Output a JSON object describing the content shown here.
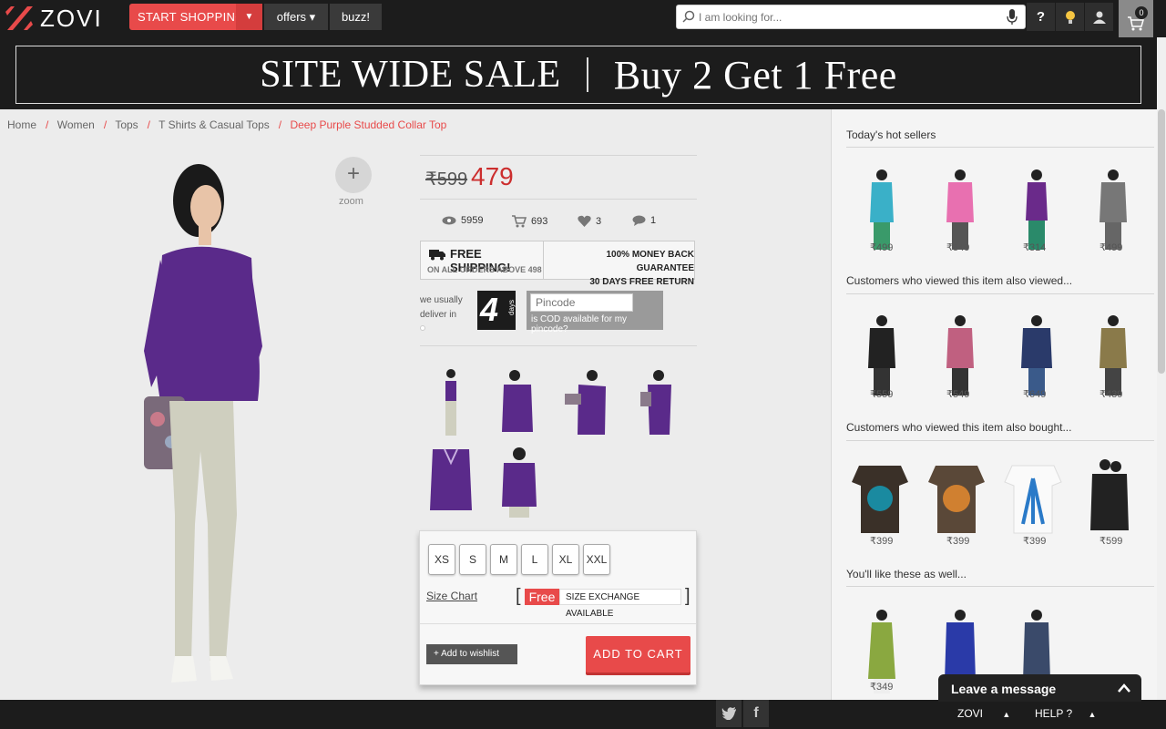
{
  "header": {
    "logo": "ZOVI",
    "start_shopping": "START SHOPPING",
    "offers": "offers",
    "buzz": "buzz!",
    "search_placeholder": "I am looking for...",
    "help_icon": "?",
    "cart_count": "0",
    "accent": "#e84a4a"
  },
  "banner": {
    "left": "SITE WIDE SALE",
    "right": "Buy 2 Get 1 Free"
  },
  "breadcrumb": [
    "Home",
    "Women",
    "Tops",
    "T Shirts & Casual Tops",
    "Deep Purple Studded Collar Top"
  ],
  "product": {
    "zoom_label": "zoom",
    "price_old": "₹599",
    "price_new": "479",
    "stats": {
      "views": "5959",
      "cart": "693",
      "likes": "3",
      "comments": "1"
    },
    "shipping": {
      "title": "FREE SHIPPING!",
      "sub": "ON ALL ORDERS ABOVE 498",
      "guarantee": "100% MONEY BACK GUARANTEE",
      "return": "30 DAYS FREE RETURN"
    },
    "delivery": {
      "label": "we usually deliver in",
      "days": "4",
      "days_word": "days",
      "pincode_placeholder": "Pincode",
      "cod_question": "is COD available for my pincode?"
    },
    "sizes": [
      "XS",
      "S",
      "M",
      "L",
      "XL",
      "XXL"
    ],
    "size_chart": "Size Chart",
    "exchange_free": "Free",
    "exchange_text": "SIZE EXCHANGE AVAILABLE",
    "wishlist": "+ Add to wishlist",
    "add_to_cart": "ADD TO CART",
    "color": "#5a2a8a"
  },
  "sidebar": {
    "sections": [
      {
        "title": "Today's hot sellers",
        "prices": [
          "₹499",
          "₹549",
          "₹314",
          "₹499"
        ]
      },
      {
        "title": "Customers who viewed this item also viewed...",
        "prices": [
          "₹559",
          "₹549",
          "₹649",
          "₹439"
        ]
      },
      {
        "title": "Customers who viewed this item also bought...",
        "prices": [
          "₹399",
          "₹399",
          "₹399",
          "₹599"
        ]
      },
      {
        "title": "You'll like these as well...",
        "prices": [
          "₹349",
          "",
          ""
        ]
      }
    ]
  },
  "footer": {
    "twitter": "twitter-icon",
    "facebook": "f",
    "zovi": "ZOVI",
    "help": "HELP ?",
    "leave_message": "Leave a message"
  }
}
